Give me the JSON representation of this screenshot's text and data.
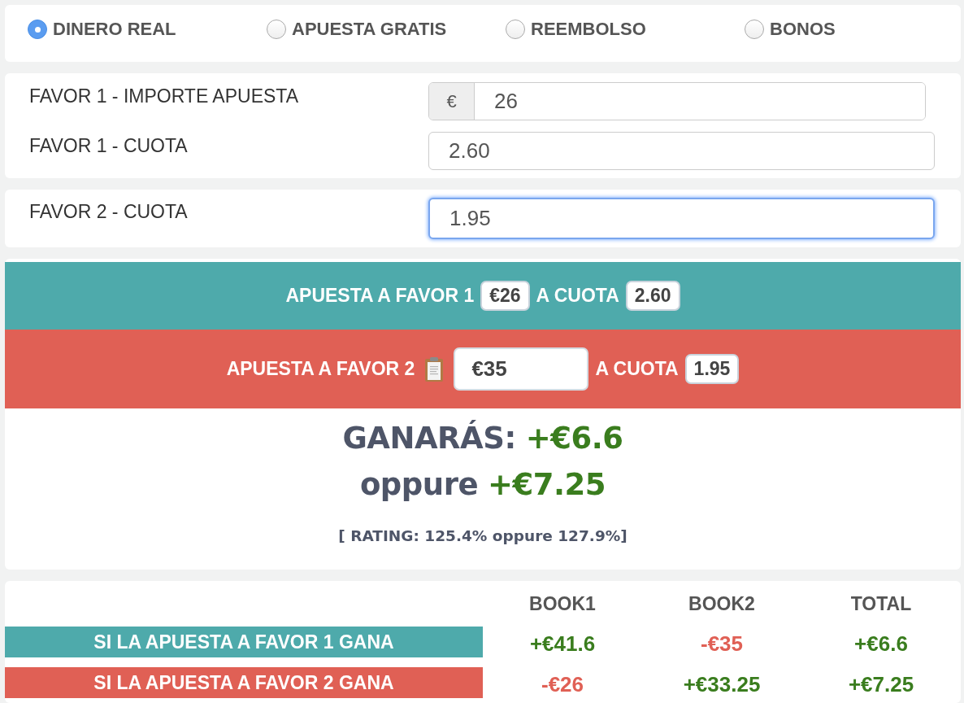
{
  "bet_types": [
    {
      "label": "DINERO REAL",
      "selected": true
    },
    {
      "label": "APUESTA GRATIS",
      "selected": false
    },
    {
      "label": "REEMBOLSO",
      "selected": false
    },
    {
      "label": "BONOS",
      "selected": false
    }
  ],
  "stake_form": {
    "fields": [
      {
        "label": "FAVOR 1 - IMPORTE APUESTA",
        "prefix": "€",
        "value": "26",
        "focused": false
      },
      {
        "label": "FAVOR 1 - CUOTA",
        "value": "2.60",
        "focused": false
      }
    ]
  },
  "lay_form": {
    "fields": [
      {
        "label": "FAVOR 2 - CUOTA",
        "value": "1.95",
        "focused": true
      }
    ]
  },
  "bets": [
    {
      "kind": "fixed",
      "color": "#4eaaab",
      "label": "APUESTA A FAVOR 1",
      "stake": "€26",
      "odds_label": "A CUOTA",
      "odds": "2.60"
    },
    {
      "kind": "editable",
      "color": "#e06055",
      "label": "APUESTA A FAVOR 2",
      "stake": "€35",
      "odds_label": "A CUOTA",
      "odds": "1.95"
    }
  ],
  "summary": {
    "profit_label": "GANARÁS:",
    "profit": "+€6.6",
    "alt_label": "oppure",
    "alt_profit": "+€7.25",
    "rating": "[ RATING: 125.4% oppure 127.9%]"
  },
  "outcomes": {
    "columns": [
      "BOOK1",
      "BOOK2",
      "TOTAL"
    ],
    "rows": [
      {
        "label": "SI LA APUESTA A FAVOR 1 GANA",
        "color": "#4eaaab",
        "cells": [
          {
            "value": "+€41.6",
            "color": "#3a7d1e"
          },
          {
            "value": "-€35",
            "color": "#e06055"
          },
          {
            "value": "+€6.6",
            "color": "#3a7d1e"
          }
        ]
      },
      {
        "label": "SI LA APUESTA A FAVOR 2 GANA",
        "color": "#e06055",
        "cells": [
          {
            "value": "-€26",
            "color": "#e06055"
          },
          {
            "value": "+€33.25",
            "color": "#3a7d1e"
          },
          {
            "value": "+€7.25",
            "color": "#3a7d1e"
          }
        ]
      }
    ]
  }
}
